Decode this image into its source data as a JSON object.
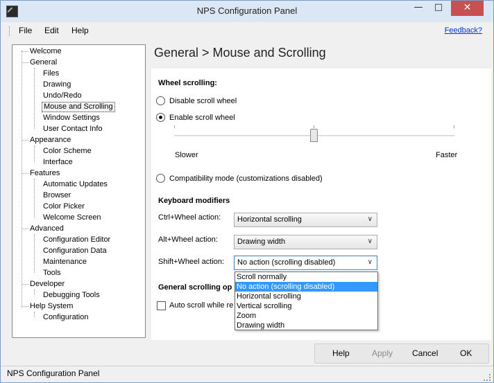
{
  "window": {
    "title": "NPS Configuration Panel",
    "min": "—",
    "max": "□",
    "close": "✕"
  },
  "menu": {
    "file": "File",
    "edit": "Edit",
    "help": "Help",
    "feedback": "Feedback?"
  },
  "tree": {
    "welcome": "Welcome",
    "general": "General",
    "files": "Files",
    "drawing": "Drawing",
    "undo": "Undo/Redo",
    "mouse": "Mouse and Scrolling",
    "window_settings": "Window Settings",
    "user_contact": "User Contact Info",
    "appearance": "Appearance",
    "color_scheme": "Color Scheme",
    "interface": "Interface",
    "features": "Features",
    "auto_updates": "Automatic Updates",
    "browser": "Browser",
    "color_picker": "Color Picker",
    "welcome_screen": "Welcome Screen",
    "advanced": "Advanced",
    "config_editor": "Configuration Editor",
    "config_data": "Configuration Data",
    "maintenance": "Maintenance",
    "tools": "Tools",
    "developer": "Developer",
    "debug_tools": "Debugging Tools",
    "help_system": "Help System",
    "configuration": "Configuration"
  },
  "content": {
    "title": "General > Mouse and Scrolling",
    "wheel_heading": "Wheel scrolling:",
    "disable_wheel": "Disable scroll wheel",
    "enable_wheel": "Enable scroll wheel",
    "slider": {
      "value": 0.5,
      "slower": "Slower",
      "faster": "Faster"
    },
    "compat": "Compatibility mode (customizations disabled)",
    "kbd_heading": "Keyboard modifiers",
    "ctrl_label": "Ctrl+Wheel action:",
    "ctrl_value": "Horizontal scrolling",
    "alt_label": "Alt+Wheel action:",
    "alt_value": "Drawing width",
    "shift_label": "Shift+Wheel action:",
    "shift_value": "No action (scrolling disabled)",
    "shift_options": [
      "Scroll normally",
      "No action (scrolling disabled)",
      "Horizontal scrolling",
      "Vertical scrolling",
      "Zoom",
      "Drawing width"
    ],
    "general_heading": "General scrolling op",
    "auto_scroll": "Auto scroll while re"
  },
  "buttons": {
    "help": "Help",
    "apply": "Apply",
    "cancel": "Cancel",
    "ok": "OK"
  },
  "status": {
    "text": "NPS Configuration Panel"
  },
  "icons": {
    "dropdown": "chevron-down-icon",
    "app": "app-icon"
  }
}
